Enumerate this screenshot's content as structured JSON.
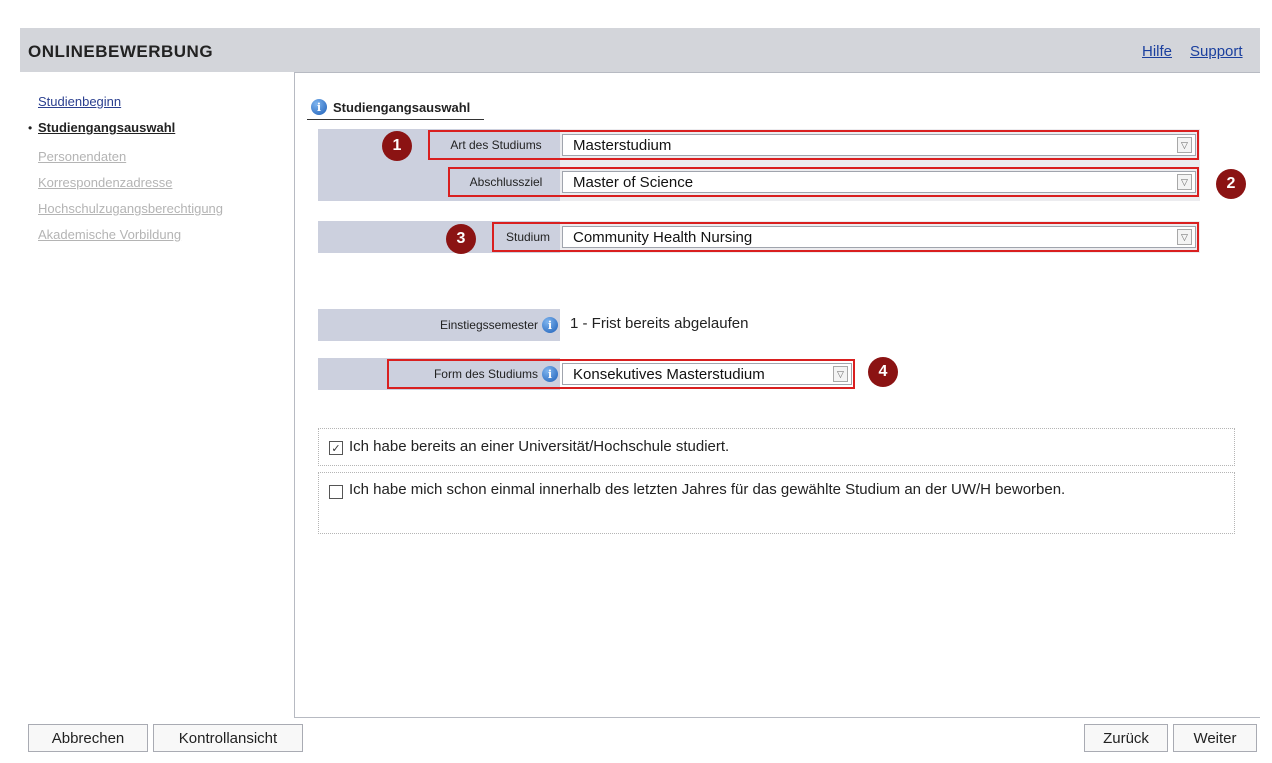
{
  "header": {
    "title": "Onlinebewerbung",
    "links": [
      "Hilfe",
      "Support"
    ]
  },
  "sidebar": {
    "items": [
      {
        "label": "Studienbeginn",
        "state": "link"
      },
      {
        "label": "Studiengangsauswahl",
        "state": "current"
      },
      {
        "label": "Personendaten",
        "state": "disabled"
      },
      {
        "label": "Korrespondenzadresse",
        "state": "disabled"
      },
      {
        "label": "Hochschulzugangsberechtigung",
        "state": "disabled"
      },
      {
        "label": "Akademische Vorbildung",
        "state": "disabled"
      }
    ]
  },
  "tab": {
    "label": "Studiengangsauswahl",
    "icon": "info-icon"
  },
  "form": {
    "art": {
      "label": "Art des Studiums",
      "value": "Masterstudium"
    },
    "abschluss": {
      "label": "Abschlussziel",
      "value": "Master of Science"
    },
    "studium": {
      "label": "Studium",
      "value": "Community Health Nursing"
    },
    "einstieg": {
      "label": "Einstiegssemester",
      "value": "1 - Frist bereits abgelaufen"
    },
    "form": {
      "label": "Form des Studiums",
      "value": "Konsekutives Masterstudium"
    }
  },
  "annotations": [
    "1",
    "2",
    "3",
    "4"
  ],
  "checkboxes": [
    {
      "label": "Ich habe bereits an einer Universität/Hochschule studiert.",
      "checked": true
    },
    {
      "label": "Ich habe mich schon einmal innerhalb des letzten Jahres für das gewählte Studium an der UW/H beworben.",
      "checked": false
    }
  ],
  "footer": {
    "cancel": "Abbrechen",
    "control": "Kontrollansicht",
    "back": "Zurück",
    "next": "Weiter"
  },
  "colors": {
    "header_bg": "#d3d5da",
    "label_bg": "#ccd0de",
    "highlight": "#d91f1f",
    "badge": "#8b1313"
  }
}
